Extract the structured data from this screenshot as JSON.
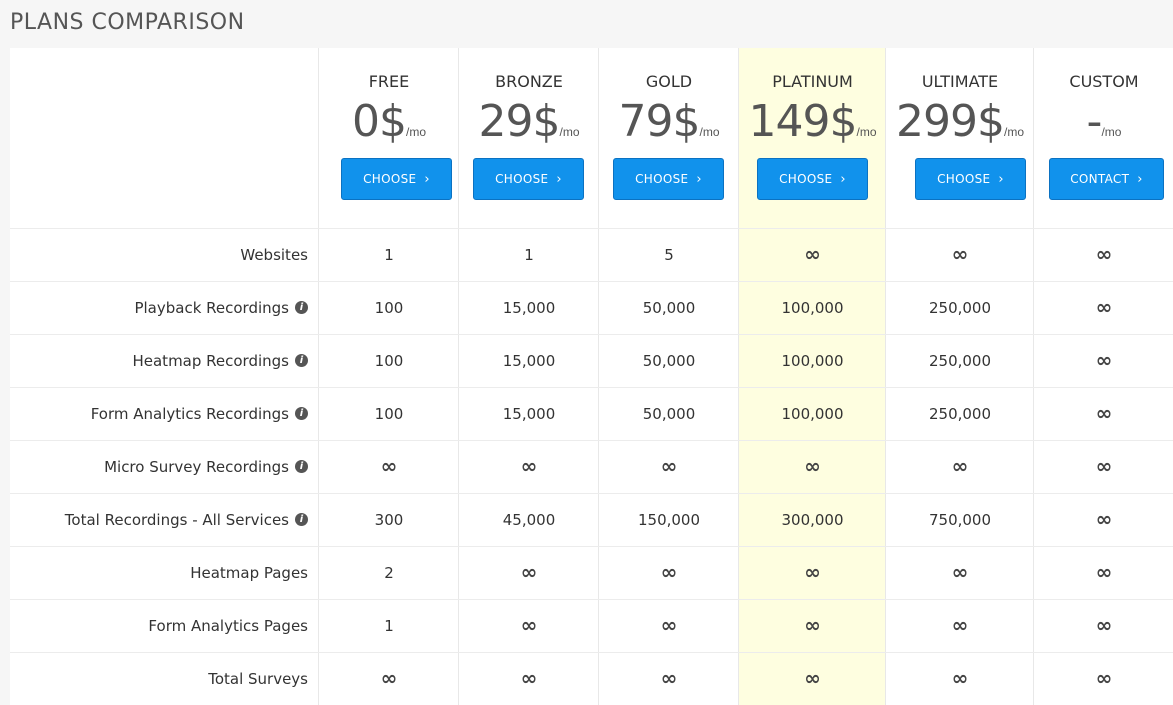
{
  "page_title": "PLANS COMPARISON",
  "plans": [
    {
      "name": "FREE",
      "price": "0$",
      "period": "/mo",
      "button": "CHOOSE",
      "highlight": false
    },
    {
      "name": "BRONZE",
      "price": "29$",
      "period": "/mo",
      "button": "CHOOSE",
      "highlight": false
    },
    {
      "name": "GOLD",
      "price": "79$",
      "period": "/mo",
      "button": "CHOOSE",
      "highlight": false
    },
    {
      "name": "PLATINUM",
      "price": "149$",
      "period": "/mo",
      "button": "CHOOSE",
      "highlight": true
    },
    {
      "name": "ULTIMATE",
      "price": "299$",
      "period": "/mo",
      "button": "CHOOSE",
      "highlight": false
    },
    {
      "name": "CUSTOM",
      "price": "-",
      "period": "/mo",
      "button": "CONTACT",
      "highlight": false
    }
  ],
  "features": [
    {
      "label": "Websites",
      "info": false,
      "values": [
        "1",
        "1",
        "5",
        "∞",
        "∞",
        "∞"
      ]
    },
    {
      "label": "Playback Recordings",
      "info": true,
      "values": [
        "100",
        "15,000",
        "50,000",
        "100,000",
        "250,000",
        "∞"
      ]
    },
    {
      "label": "Heatmap Recordings",
      "info": true,
      "values": [
        "100",
        "15,000",
        "50,000",
        "100,000",
        "250,000",
        "∞"
      ]
    },
    {
      "label": "Form Analytics Recordings",
      "info": true,
      "values": [
        "100",
        "15,000",
        "50,000",
        "100,000",
        "250,000",
        "∞"
      ]
    },
    {
      "label": "Micro Survey Recordings",
      "info": true,
      "values": [
        "∞",
        "∞",
        "∞",
        "∞",
        "∞",
        "∞"
      ]
    },
    {
      "label": "Total Recordings - All Services",
      "info": true,
      "values": [
        "300",
        "45,000",
        "150,000",
        "300,000",
        "750,000",
        "∞"
      ]
    },
    {
      "label": "Heatmap Pages",
      "info": false,
      "values": [
        "2",
        "∞",
        "∞",
        "∞",
        "∞",
        "∞"
      ]
    },
    {
      "label": "Form Analytics Pages",
      "info": false,
      "values": [
        "1",
        "∞",
        "∞",
        "∞",
        "∞",
        "∞"
      ]
    },
    {
      "label": "Total Surveys",
      "info": false,
      "values": [
        "∞",
        "∞",
        "∞",
        "∞",
        "∞",
        "∞"
      ]
    }
  ],
  "icons": {
    "button_chevron": "chevron-right-icon",
    "info": "info-icon"
  },
  "colors": {
    "button": "#1192ec",
    "highlight": "#fefee0"
  }
}
